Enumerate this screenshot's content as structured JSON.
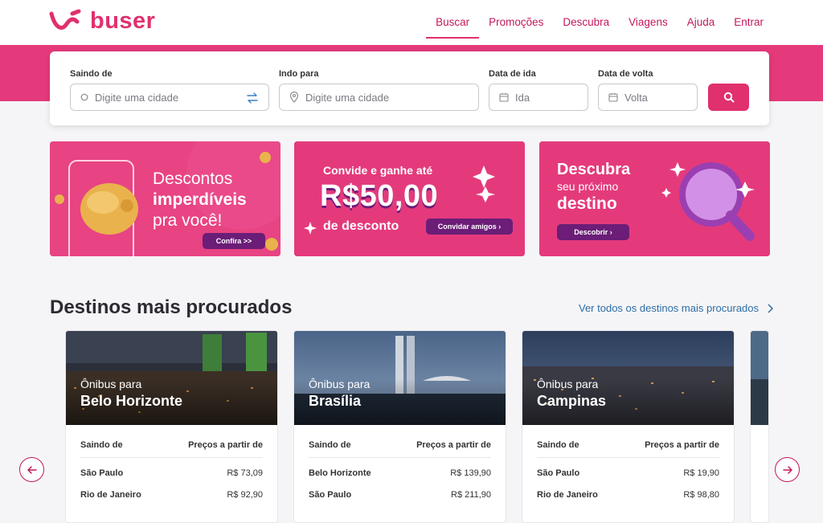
{
  "brand": {
    "name": "buser",
    "accent": "#e0306e",
    "accent_dark": "#c2185b",
    "band": "#e43a7c"
  },
  "nav": {
    "items": [
      {
        "label": "Buscar",
        "active": true
      },
      {
        "label": "Promoções"
      },
      {
        "label": "Descubra"
      },
      {
        "label": "Viagens"
      },
      {
        "label": "Ajuda"
      },
      {
        "label": "Entrar"
      }
    ]
  },
  "search": {
    "from_label": "Saindo de",
    "from_placeholder": "Digite uma cidade",
    "to_label": "Indo para",
    "to_placeholder": "Digite uma cidade",
    "depart_label": "Data de ida",
    "depart_placeholder": "Ida",
    "return_label": "Data de volta",
    "return_placeholder": "Volta"
  },
  "banners": {
    "b1": {
      "line1": "Descontos",
      "line2": "imperdíveis",
      "line3": "pra você!",
      "button": "Confira >>"
    },
    "b2": {
      "line1": "Convide e ganhe até",
      "amount": "R$50,00",
      "line3": "de desconto",
      "button": "Convidar amigos"
    },
    "b3": {
      "line1": "Descubra",
      "line2": "seu próximo",
      "line3": "destino",
      "button": "Descobrir"
    }
  },
  "destinations": {
    "title": "Destinos mais procurados",
    "see_all": "Ver todos os destinos mais procurados",
    "cards": [
      {
        "prefix": "Ônibus para",
        "city": "Belo Horizonte",
        "col1": "Saindo de",
        "col2": "Preços a partir de",
        "rows": [
          {
            "from": "São Paulo",
            "price": "R$ 73,09"
          },
          {
            "from": "Rio de Janeiro",
            "price": "R$ 92,90"
          }
        ]
      },
      {
        "prefix": "Ônibus para",
        "city": "Brasília",
        "col1": "Saindo de",
        "col2": "Preços a partir de",
        "rows": [
          {
            "from": "Belo Horizonte",
            "price": "R$ 139,90"
          },
          {
            "from": "São Paulo",
            "price": "R$ 211,90"
          }
        ]
      },
      {
        "prefix": "Ônibus para",
        "city": "Campinas",
        "col1": "Saindo de",
        "col2": "Preços a partir de",
        "rows": [
          {
            "from": "São Paulo",
            "price": "R$ 19,90"
          },
          {
            "from": "Rio de Janeiro",
            "price": "R$ 98,80"
          }
        ]
      }
    ]
  }
}
